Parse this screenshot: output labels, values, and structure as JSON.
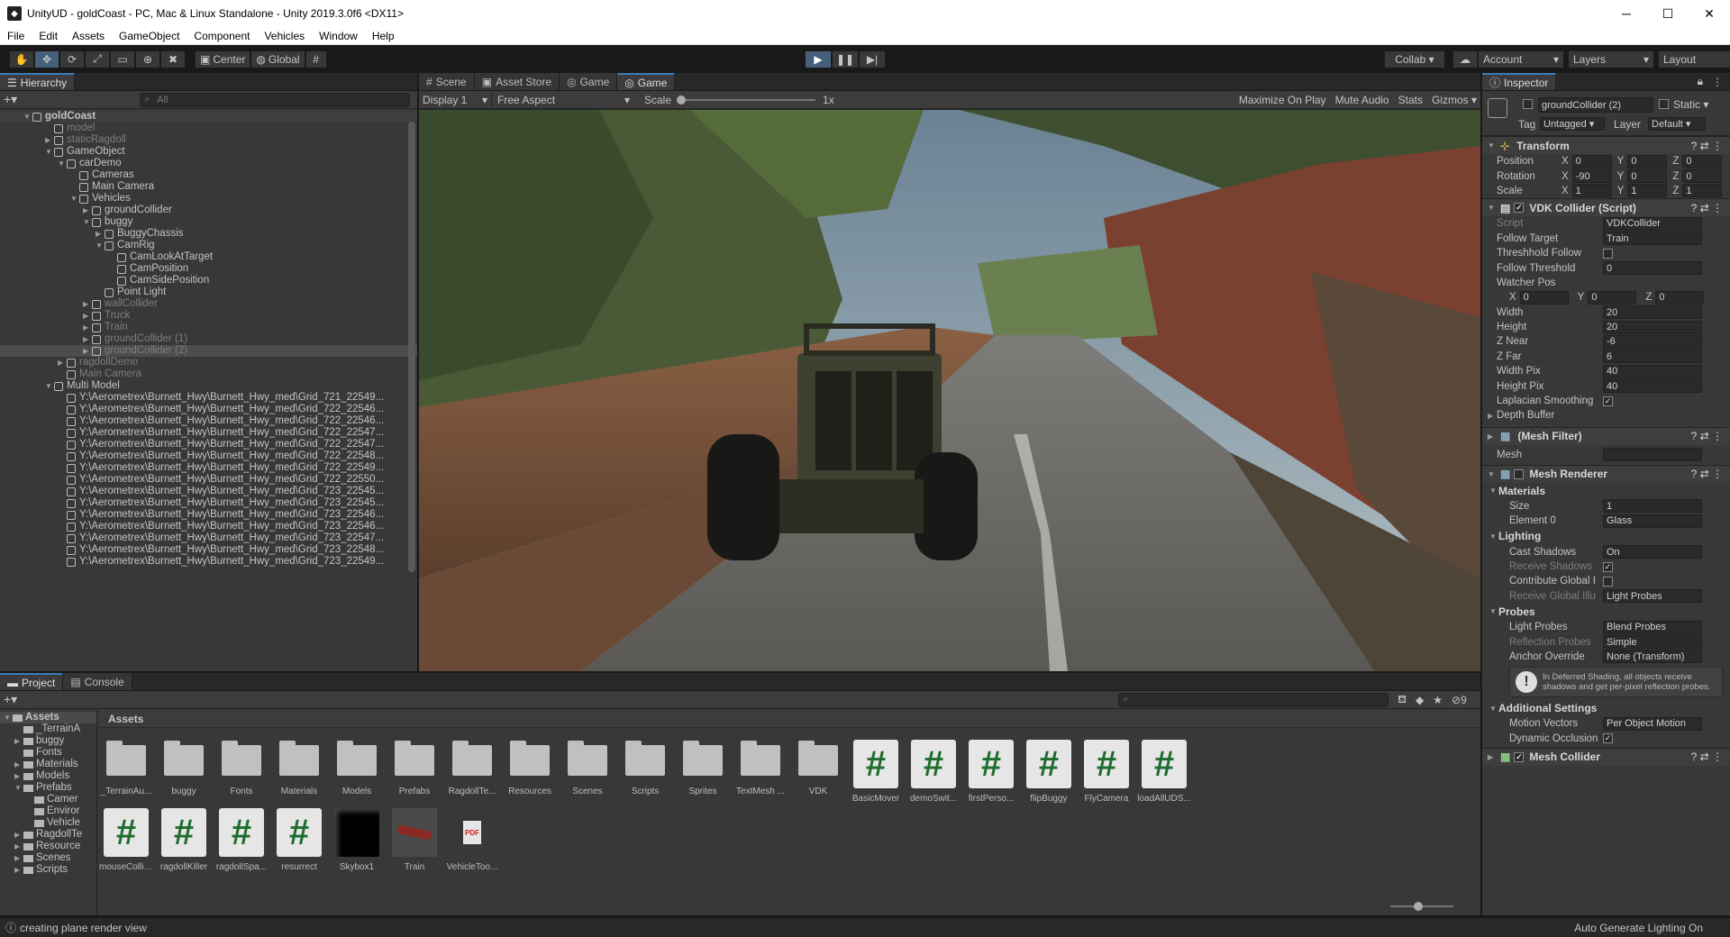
{
  "window": {
    "title": "UnityUD - goldCoast - PC, Mac & Linux Standalone - Unity 2019.3.0f6 <DX11>"
  },
  "menu": [
    "File",
    "Edit",
    "Assets",
    "GameObject",
    "Component",
    "Vehicles",
    "Window",
    "Help"
  ],
  "toolbar": {
    "pivot": "Center",
    "space": "Global",
    "collab": "Collab",
    "account": "Account",
    "layers": "Layers",
    "layout": "Layout"
  },
  "hierarchy": {
    "tab": "Hierarchy",
    "search_placeholder": "All",
    "items": [
      {
        "label": "goldCoast",
        "indent": 0,
        "arrow": "▼",
        "dim": false,
        "scene": true
      },
      {
        "label": "model",
        "indent": 1,
        "arrow": "",
        "dim": true
      },
      {
        "label": "staticRagdoll",
        "indent": 1,
        "arrow": "▶",
        "dim": true
      },
      {
        "label": "GameObject",
        "indent": 1,
        "arrow": "▼",
        "dim": false
      },
      {
        "label": "carDemo",
        "indent": 2,
        "arrow": "▼",
        "dim": false
      },
      {
        "label": "Cameras",
        "indent": 3,
        "arrow": "",
        "dim": false
      },
      {
        "label": "Main Camera",
        "indent": 3,
        "arrow": "",
        "dim": false
      },
      {
        "label": "Vehicles",
        "indent": 3,
        "arrow": "▼",
        "dim": false
      },
      {
        "label": "groundCollider",
        "indent": 4,
        "arrow": "▶",
        "dim": false
      },
      {
        "label": "buggy",
        "indent": 4,
        "arrow": "▼",
        "dim": false
      },
      {
        "label": "BuggyChassis",
        "indent": 5,
        "arrow": "▶",
        "dim": false
      },
      {
        "label": "CamRig",
        "indent": 5,
        "arrow": "▼",
        "dim": false
      },
      {
        "label": "CamLookAtTarget",
        "indent": 6,
        "arrow": "",
        "dim": false
      },
      {
        "label": "CamPosition",
        "indent": 6,
        "arrow": "",
        "dim": false
      },
      {
        "label": "CamSidePosition",
        "indent": 6,
        "arrow": "",
        "dim": false
      },
      {
        "label": "Point Light",
        "indent": 5,
        "arrow": "",
        "dim": false
      },
      {
        "label": "wallCollider",
        "indent": 4,
        "arrow": "▶",
        "dim": true
      },
      {
        "label": "Truck",
        "indent": 4,
        "arrow": "▶",
        "dim": true
      },
      {
        "label": "Train",
        "indent": 4,
        "arrow": "▶",
        "dim": true
      },
      {
        "label": "groundCollider (1)",
        "indent": 4,
        "arrow": "▶",
        "dim": true
      },
      {
        "label": "groundCollider (2)",
        "indent": 4,
        "arrow": "▶",
        "dim": true,
        "selected": true
      },
      {
        "label": "ragdollDemo",
        "indent": 2,
        "arrow": "▶",
        "dim": true
      },
      {
        "label": "Main Camera",
        "indent": 2,
        "arrow": "",
        "dim": true
      },
      {
        "label": "Multi Model",
        "indent": 1,
        "arrow": "▼",
        "dim": false
      },
      {
        "label": "Y:\\Aerometrex\\Burnett_Hwy\\Burnett_Hwy_med\\Grid_721_22549...",
        "indent": 2,
        "arrow": "",
        "dim": false
      },
      {
        "label": "Y:\\Aerometrex\\Burnett_Hwy\\Burnett_Hwy_med\\Grid_722_22546...",
        "indent": 2,
        "arrow": "",
        "dim": false
      },
      {
        "label": "Y:\\Aerometrex\\Burnett_Hwy\\Burnett_Hwy_med\\Grid_722_22546...",
        "indent": 2,
        "arrow": "",
        "dim": false
      },
      {
        "label": "Y:\\Aerometrex\\Burnett_Hwy\\Burnett_Hwy_med\\Grid_722_22547...",
        "indent": 2,
        "arrow": "",
        "dim": false
      },
      {
        "label": "Y:\\Aerometrex\\Burnett_Hwy\\Burnett_Hwy_med\\Grid_722_22547...",
        "indent": 2,
        "arrow": "",
        "dim": false
      },
      {
        "label": "Y:\\Aerometrex\\Burnett_Hwy\\Burnett_Hwy_med\\Grid_722_22548...",
        "indent": 2,
        "arrow": "",
        "dim": false
      },
      {
        "label": "Y:\\Aerometrex\\Burnett_Hwy\\Burnett_Hwy_med\\Grid_722_22549...",
        "indent": 2,
        "arrow": "",
        "dim": false
      },
      {
        "label": "Y:\\Aerometrex\\Burnett_Hwy\\Burnett_Hwy_med\\Grid_722_22550...",
        "indent": 2,
        "arrow": "",
        "dim": false
      },
      {
        "label": "Y:\\Aerometrex\\Burnett_Hwy\\Burnett_Hwy_med\\Grid_723_22545...",
        "indent": 2,
        "arrow": "",
        "dim": false
      },
      {
        "label": "Y:\\Aerometrex\\Burnett_Hwy\\Burnett_Hwy_med\\Grid_723_22545...",
        "indent": 2,
        "arrow": "",
        "dim": false
      },
      {
        "label": "Y:\\Aerometrex\\Burnett_Hwy\\Burnett_Hwy_med\\Grid_723_22546...",
        "indent": 2,
        "arrow": "",
        "dim": false
      },
      {
        "label": "Y:\\Aerometrex\\Burnett_Hwy\\Burnett_Hwy_med\\Grid_723_22546...",
        "indent": 2,
        "arrow": "",
        "dim": false
      },
      {
        "label": "Y:\\Aerometrex\\Burnett_Hwy\\Burnett_Hwy_med\\Grid_723_22547...",
        "indent": 2,
        "arrow": "",
        "dim": false
      },
      {
        "label": "Y:\\Aerometrex\\Burnett_Hwy\\Burnett_Hwy_med\\Grid_723_22548...",
        "indent": 2,
        "arrow": "",
        "dim": false
      },
      {
        "label": "Y:\\Aerometrex\\Burnett_Hwy\\Burnett_Hwy_med\\Grid_723_22549...",
        "indent": 2,
        "arrow": "",
        "dim": false
      }
    ]
  },
  "game": {
    "tabs": [
      "Scene",
      "Asset Store",
      "Game",
      "Game"
    ],
    "display": "Display 1",
    "aspect": "Free Aspect",
    "scale_label": "Scale",
    "scale_value": "1x",
    "maximize": "Maximize On Play",
    "mute": "Mute Audio",
    "stats": "Stats",
    "gizmos": "Gizmos"
  },
  "inspector": {
    "tab": "Inspector",
    "object_name": "groundCollider (2)",
    "static_label": "Static",
    "tag_label": "Tag",
    "tag_value": "Untagged",
    "layer_label": "Layer",
    "layer_value": "Default",
    "transform": {
      "title": "Transform",
      "rows": [
        {
          "label": "Position",
          "x": "0",
          "y": "0",
          "z": "0"
        },
        {
          "label": "Rotation",
          "x": "-90",
          "y": "0",
          "z": "0"
        },
        {
          "label": "Scale",
          "x": "1",
          "y": "1",
          "z": "1"
        }
      ]
    },
    "vdk": {
      "title": "VDK Collider (Script)",
      "script_label": "Script",
      "script_value": "VDKCollider",
      "follow_target_label": "Follow Target",
      "follow_target_value": "Train",
      "threshold_follow_label": "Threshhold Follow",
      "follow_threshold_label": "Follow Threshold",
      "follow_threshold_value": "0",
      "watcher_label": "Watcher Pos",
      "wx": "0",
      "wy": "0",
      "wz": "0",
      "fields": [
        {
          "label": "Width",
          "value": "20"
        },
        {
          "label": "Height",
          "value": "20"
        },
        {
          "label": "Z Near",
          "value": "-6"
        },
        {
          "label": "Z Far",
          "value": "6"
        },
        {
          "label": "Width Pix",
          "value": "40"
        },
        {
          "label": "Height Pix",
          "value": "40"
        }
      ],
      "laplacian_label": "Laplacian Smoothing",
      "depth_label": "Depth Buffer"
    },
    "meshfilter": {
      "title": "(Mesh Filter)",
      "mesh_label": "Mesh"
    },
    "renderer": {
      "title": "Mesh Renderer",
      "materials": "Materials",
      "size_label": "Size",
      "size_value": "1",
      "element_label": "Element 0",
      "element_value": "Glass",
      "lighting": "Lighting",
      "cast_label": "Cast Shadows",
      "cast_value": "On",
      "receive_label": "Receive Shadows",
      "contribute_label": "Contribute Global I",
      "receive_gi_label": "Receive Global Illu",
      "receive_gi_value": "Light Probes",
      "probes": "Probes",
      "light_probes_label": "Light Probes",
      "light_probes_value": "Blend Probes",
      "reflection_label": "Reflection Probes",
      "reflection_value": "Simple",
      "anchor_label": "Anchor Override",
      "anchor_value": "None (Transform)",
      "info": "In Deferred Shading, all objects receive shadows and get per-pixel reflection probes.",
      "additional": "Additional Settings",
      "motion_label": "Motion Vectors",
      "motion_value": "Per Object Motion",
      "dynamic_label": "Dynamic Occlusion"
    },
    "meshcollider": {
      "title": "Mesh Collider"
    }
  },
  "project": {
    "tabs": [
      "Project",
      "Console"
    ],
    "breadcrumb": "Assets",
    "hidden_count": "9",
    "tree": [
      {
        "label": "Assets",
        "indent": 0,
        "arrow": "▼",
        "bold": true
      },
      {
        "label": "_TerrainA",
        "indent": 1,
        "arrow": ""
      },
      {
        "label": "buggy",
        "indent": 1,
        "arrow": "▶"
      },
      {
        "label": "Fonts",
        "indent": 1,
        "arrow": ""
      },
      {
        "label": "Materials",
        "indent": 1,
        "arrow": "▶"
      },
      {
        "label": "Models",
        "indent": 1,
        "arrow": "▶"
      },
      {
        "label": "Prefabs",
        "indent": 1,
        "arrow": "▼"
      },
      {
        "label": "Camer",
        "indent": 2,
        "arrow": ""
      },
      {
        "label": "Enviror",
        "indent": 2,
        "arrow": ""
      },
      {
        "label": "Vehicle",
        "indent": 2,
        "arrow": ""
      },
      {
        "label": "RagdollTe",
        "indent": 1,
        "arrow": "▶"
      },
      {
        "label": "Resource",
        "indent": 1,
        "arrow": "▶"
      },
      {
        "label": "Scenes",
        "indent": 1,
        "arrow": "▶"
      },
      {
        "label": "Scripts",
        "indent": 1,
        "arrow": "▶"
      }
    ],
    "assets_row1": [
      {
        "name": "_TerrainAu...",
        "kind": "folder"
      },
      {
        "name": "buggy",
        "kind": "folder"
      },
      {
        "name": "Fonts",
        "kind": "folder"
      },
      {
        "name": "Materials",
        "kind": "folder"
      },
      {
        "name": "Models",
        "kind": "folder"
      },
      {
        "name": "Prefabs",
        "kind": "folder"
      },
      {
        "name": "RagdollTe...",
        "kind": "folder"
      },
      {
        "name": "Resources",
        "kind": "folder"
      },
      {
        "name": "Scenes",
        "kind": "folder"
      },
      {
        "name": "Scripts",
        "kind": "folder"
      },
      {
        "name": "Sprites",
        "kind": "folder"
      },
      {
        "name": "TextMesh ...",
        "kind": "folder"
      },
      {
        "name": "VDK",
        "kind": "folder"
      },
      {
        "name": "BasicMover",
        "kind": "script"
      },
      {
        "name": "demoSwit...",
        "kind": "script"
      },
      {
        "name": "firstPerso...",
        "kind": "script"
      },
      {
        "name": "flipBuggy",
        "kind": "script"
      },
      {
        "name": "FlyCamera",
        "kind": "script"
      },
      {
        "name": "loadAllUDS...",
        "kind": "script"
      }
    ],
    "assets_row2": [
      {
        "name": "mouseCollis...",
        "kind": "script"
      },
      {
        "name": "ragdollKiller",
        "kind": "script"
      },
      {
        "name": "ragdollSpa...",
        "kind": "script"
      },
      {
        "name": "resurrect",
        "kind": "script"
      },
      {
        "name": "Skybox1",
        "kind": "skybox"
      },
      {
        "name": "Train",
        "kind": "train"
      },
      {
        "name": "VehicleToo...",
        "kind": "pdf"
      }
    ]
  },
  "status": {
    "message": "creating plane render view",
    "right": "Auto Generate Lighting On"
  }
}
